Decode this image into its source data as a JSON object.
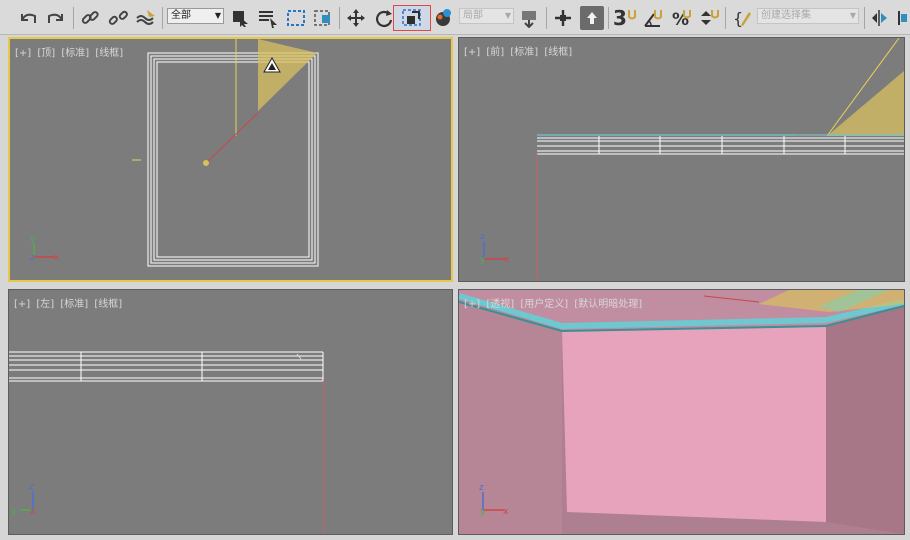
{
  "toolbar": {
    "undo_icon": "undo-icon",
    "redo_icon": "redo-icon",
    "link_icon": "link-icon",
    "unlink_icon": "unlink-icon",
    "bind_space_warp_icon": "bind-spacewarp-icon",
    "selection_filter": "全部",
    "select_object_icon": "select-object-icon",
    "select_by_name_icon": "select-by-name-icon",
    "rect_region_icon": "rectangular-selection-icon",
    "window_crossing_icon": "window-crossing-icon",
    "move_icon": "move-icon",
    "rotate_icon": "rotate-icon",
    "scale_icon": "scale-icon",
    "material_icon": "material-sphere-icon",
    "reference_coord": "局部",
    "pivot_icon": "pivot-icon",
    "manipulate_icon": "manipulate-icon",
    "keyboard_shortcut_icon": "keyboard-shortcut-icon",
    "snap_3d_label": "3",
    "angle_snap_icon": "angle-snap-icon",
    "percent_snap_icon": "percent-snap-icon",
    "spinner_snap_icon": "spinner-snap-icon",
    "edit_named_sets_icon": "edit-named-selection-icon",
    "named_selection_placeholder": "创建选择集",
    "mirror_icon": "mirror-icon"
  },
  "viewports": {
    "top": {
      "labels": [
        "[+]",
        "[顶]",
        "[标准]",
        "[线框]"
      ]
    },
    "front": {
      "labels": [
        "[+]",
        "[前]",
        "[标准]",
        "[线框]"
      ]
    },
    "left": {
      "labels": [
        "[+]",
        "[左]",
        "[标准]",
        "[线框]"
      ]
    },
    "perspective": {
      "labels": [
        "[+]",
        "[透视]",
        "[用户定义]",
        "[默认明暗处理]"
      ]
    }
  },
  "axis": {
    "x": "x",
    "y": "y",
    "z": "z"
  },
  "colors": {
    "viewport_bg": "#7c7c7c",
    "active_border": "#e8c84a",
    "wireframe": "#ffffff",
    "light_cone": "#d8c060",
    "wall_pink": "#e6a3bb",
    "ceiling_cyan": "#6fc7cf"
  }
}
